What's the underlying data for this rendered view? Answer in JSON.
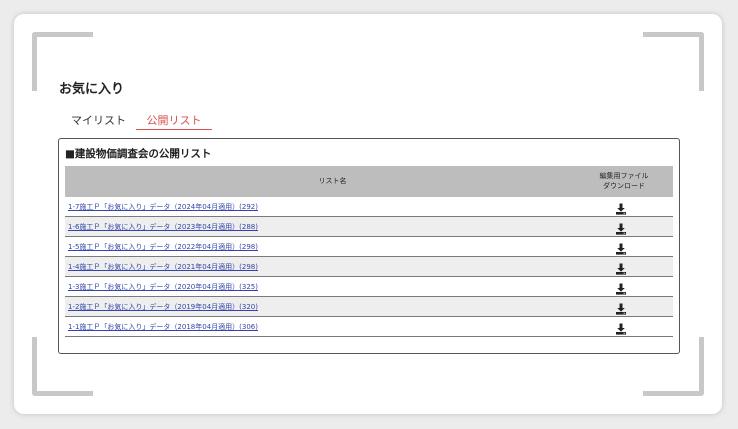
{
  "page_title": "お気に入り",
  "tabs": [
    {
      "label": "マイリスト",
      "active": false
    },
    {
      "label": "公開リスト",
      "active": true
    }
  ],
  "panel": {
    "title": "■建設物価調査会の公開リスト",
    "columns": {
      "name": "リスト名",
      "download_line1": "編集用ファイル",
      "download_line2": "ダウンロード"
    },
    "rows": [
      {
        "label": "1-7施工Ｐ「お気に入り」データ（2024年04月適用）(292)"
      },
      {
        "label": "1-6施工Ｐ「お気に入り」データ（2023年04月適用）(288)"
      },
      {
        "label": "1-5施工Ｐ「お気に入り」データ（2022年04月適用）(298)"
      },
      {
        "label": "1-4施工Ｐ「お気に入り」データ（2021年04月適用）(298)"
      },
      {
        "label": "1-3施工Ｐ「お気に入り」データ（2020年04月適用）(325)"
      },
      {
        "label": "1-2施工Ｐ「お気に入り」データ（2019年04月適用）(320)"
      },
      {
        "label": "1-1施工Ｐ「お気に入り」データ（2018年04月適用）(306)"
      }
    ]
  },
  "colors": {
    "accent": "#d9534f",
    "link": "#3344aa",
    "header_bg": "#bdbdbd",
    "row_alt_bg": "#eeeeee"
  },
  "icons": {
    "download": "download-icon"
  }
}
